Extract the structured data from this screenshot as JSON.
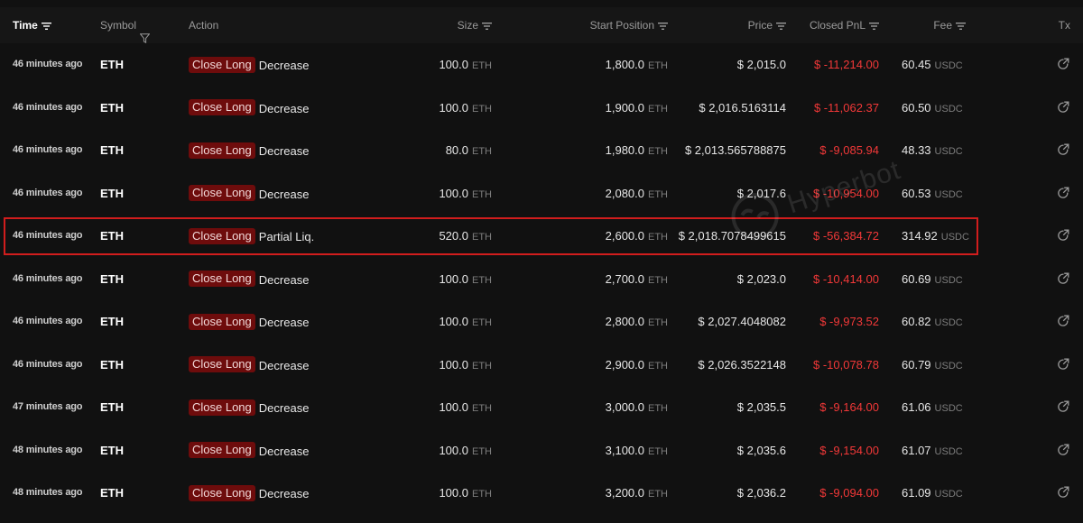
{
  "header": {
    "time": "Time",
    "symbol": "Symbol",
    "action": "Action",
    "size": "Size",
    "start_position": "Start Position",
    "price": "Price",
    "closed_pnl": "Closed PnL",
    "fee": "Fee",
    "tx": "Tx"
  },
  "watermark": "Hyperbot",
  "colors": {
    "badge_bg": "#6e0c0c",
    "pnl_negative": "#f23838",
    "highlight_border": "#d11d1d"
  },
  "rows": [
    {
      "time": "46 minutes ago",
      "symbol": "ETH",
      "side": "Close Long",
      "dir": "Decrease",
      "size": "100.0",
      "size_unit": "ETH",
      "start": "1,800.0",
      "start_unit": "ETH",
      "price": "$ 2,015.0",
      "pnl": "$ -11,214.00",
      "fee": "60.45",
      "fee_unit": "USDC"
    },
    {
      "time": "46 minutes ago",
      "symbol": "ETH",
      "side": "Close Long",
      "dir": "Decrease",
      "size": "100.0",
      "size_unit": "ETH",
      "start": "1,900.0",
      "start_unit": "ETH",
      "price": "$ 2,016.5163114",
      "pnl": "$ -11,062.37",
      "fee": "60.50",
      "fee_unit": "USDC"
    },
    {
      "time": "46 minutes ago",
      "symbol": "ETH",
      "side": "Close Long",
      "dir": "Decrease",
      "size": "80.0",
      "size_unit": "ETH",
      "start": "1,980.0",
      "start_unit": "ETH",
      "price": "$ 2,013.565788875",
      "pnl": "$ -9,085.94",
      "fee": "48.33",
      "fee_unit": "USDC"
    },
    {
      "time": "46 minutes ago",
      "symbol": "ETH",
      "side": "Close Long",
      "dir": "Decrease",
      "size": "100.0",
      "size_unit": "ETH",
      "start": "2,080.0",
      "start_unit": "ETH",
      "price": "$ 2,017.6",
      "pnl": "$ -10,954.00",
      "fee": "60.53",
      "fee_unit": "USDC"
    },
    {
      "time": "46 minutes ago",
      "symbol": "ETH",
      "side": "Close Long",
      "dir": "Partial Liq.",
      "size": "520.0",
      "size_unit": "ETH",
      "start": "2,600.0",
      "start_unit": "ETH",
      "price": "$ 2,018.7078499615",
      "pnl": "$ -56,384.72",
      "fee": "314.92",
      "fee_unit": "USDC",
      "highlighted": true
    },
    {
      "time": "46 minutes ago",
      "symbol": "ETH",
      "side": "Close Long",
      "dir": "Decrease",
      "size": "100.0",
      "size_unit": "ETH",
      "start": "2,700.0",
      "start_unit": "ETH",
      "price": "$ 2,023.0",
      "pnl": "$ -10,414.00",
      "fee": "60.69",
      "fee_unit": "USDC"
    },
    {
      "time": "46 minutes ago",
      "symbol": "ETH",
      "side": "Close Long",
      "dir": "Decrease",
      "size": "100.0",
      "size_unit": "ETH",
      "start": "2,800.0",
      "start_unit": "ETH",
      "price": "$ 2,027.4048082",
      "pnl": "$ -9,973.52",
      "fee": "60.82",
      "fee_unit": "USDC"
    },
    {
      "time": "46 minutes ago",
      "symbol": "ETH",
      "side": "Close Long",
      "dir": "Decrease",
      "size": "100.0",
      "size_unit": "ETH",
      "start": "2,900.0",
      "start_unit": "ETH",
      "price": "$ 2,026.3522148",
      "pnl": "$ -10,078.78",
      "fee": "60.79",
      "fee_unit": "USDC"
    },
    {
      "time": "47 minutes ago",
      "symbol": "ETH",
      "side": "Close Long",
      "dir": "Decrease",
      "size": "100.0",
      "size_unit": "ETH",
      "start": "3,000.0",
      "start_unit": "ETH",
      "price": "$ 2,035.5",
      "pnl": "$ -9,164.00",
      "fee": "61.06",
      "fee_unit": "USDC"
    },
    {
      "time": "48 minutes ago",
      "symbol": "ETH",
      "side": "Close Long",
      "dir": "Decrease",
      "size": "100.0",
      "size_unit": "ETH",
      "start": "3,100.0",
      "start_unit": "ETH",
      "price": "$ 2,035.6",
      "pnl": "$ -9,154.00",
      "fee": "61.07",
      "fee_unit": "USDC"
    },
    {
      "time": "48 minutes ago",
      "symbol": "ETH",
      "side": "Close Long",
      "dir": "Decrease",
      "size": "100.0",
      "size_unit": "ETH",
      "start": "3,200.0",
      "start_unit": "ETH",
      "price": "$ 2,036.2",
      "pnl": "$ -9,094.00",
      "fee": "61.09",
      "fee_unit": "USDC"
    }
  ]
}
